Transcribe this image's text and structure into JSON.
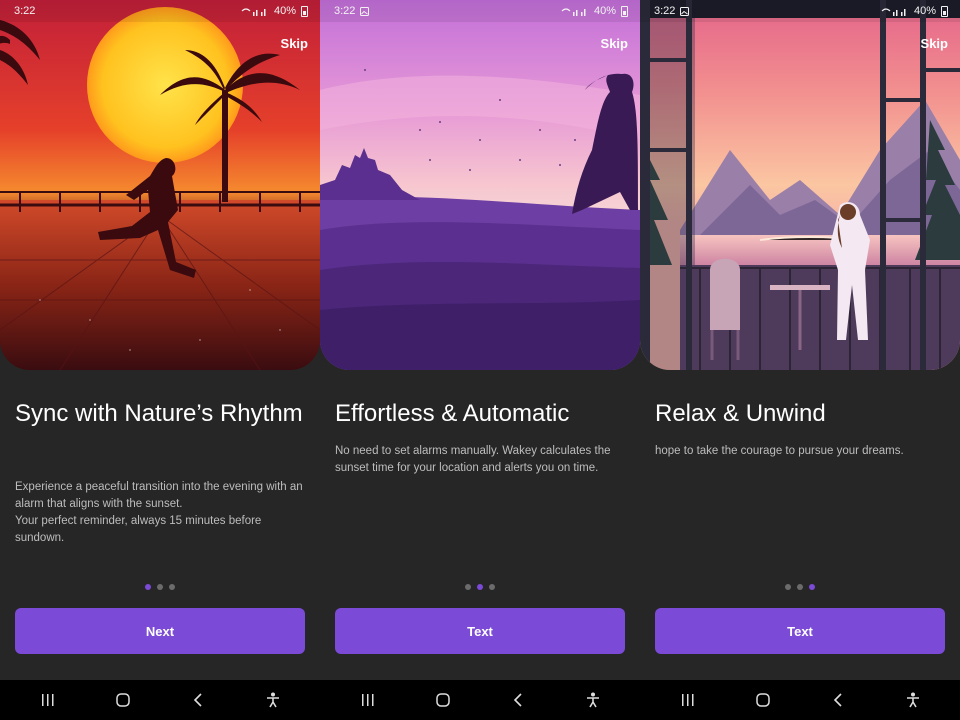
{
  "status_bar": {
    "time": "3:22",
    "battery": "40%"
  },
  "screens": [
    {
      "skip": "Skip",
      "title": "Sync with Nature’s Rhythm",
      "description": [
        "Experience a peaceful transition into the evening with an alarm that aligns with the sunset.",
        "Your perfect reminder, always 15 minutes before sundown."
      ],
      "active_dot": 0,
      "button": "Next",
      "hero_image": "sunset-runner-illustration"
    },
    {
      "skip": "Skip",
      "title": "Effortless & Automatic",
      "description": [
        "No need to set alarms manually. Wakey calculates the sunset time for your location and alerts you on time."
      ],
      "active_dot": 1,
      "button": "Text",
      "hero_image": "purple-dusk-woman-illustration"
    },
    {
      "skip": "Skip",
      "title": "Relax & Unwind",
      "description": [
        "hope to take the courage to pursue your dreams."
      ],
      "active_dot": 2,
      "button": "Text",
      "hero_image": "balcony-lake-sunset-illustration"
    }
  ],
  "pagination": {
    "count": 3
  },
  "nav_icons": [
    "recent-apps-icon",
    "home-icon",
    "back-icon",
    "accessibility-icon"
  ],
  "colors": {
    "accent": "#7B4AD6",
    "background": "#262626",
    "dot_inactive": "#6B6B6B"
  }
}
